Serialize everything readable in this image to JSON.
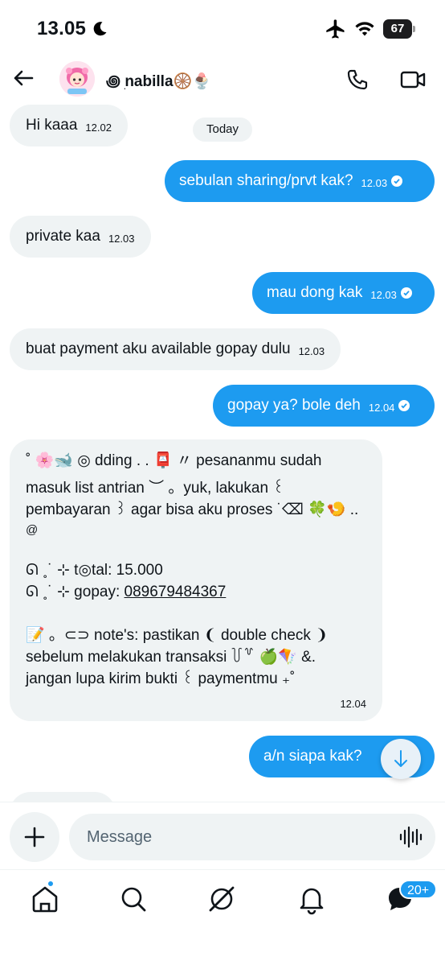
{
  "status_bar": {
    "time": "13.05",
    "battery": "67"
  },
  "header": {
    "back_label": "Back",
    "contact_name": "꩜ ׅnabilla🛞🍨"
  },
  "chat": {
    "date_separator": "Today",
    "messages": [
      {
        "dir": "in",
        "text": "Hi kaaa",
        "time": "12.02"
      },
      {
        "dir": "out",
        "text": "sebulan sharing/prvt kak?",
        "time": "12.03"
      },
      {
        "dir": "in",
        "text": "private kaa",
        "time": "12.03"
      },
      {
        "dir": "out",
        "text": "mau dong kak",
        "time": "12.03"
      },
      {
        "dir": "in",
        "text": "buat payment aku available gopay dulu",
        "time": "12.03"
      },
      {
        "dir": "out",
        "text": "gopay ya? bole deh",
        "time": "12.04"
      },
      {
        "dir": "out",
        "text": "a/n siapa kak?",
        "time": "12.04"
      }
    ],
    "long_message": {
      "lines": [
        "˚ 🌸🐋 ◎ dding . . 📮 〃 pesananmu sudah",
        "masuk list antrian ︶ 。yuk, lakukan ꒰",
        "pembayaran ꒱ agar bisa aku proses ˙⌫ 🍀🍤 ..",
        "@",
        "",
        "ᘏ ˳˙ ⊹ t◎tal: 15.000",
        "ᘏ ˳˙ ⊹ gopay: ",
        "",
        "📝 。⊂⊃ note's: pastikan ❨ double check ❩",
        "sebelum melakukan transaksi ꒦꒷ 🍏🪁 &.",
        "jangan lupa kirim bukti ꒰ paymentmu ₊˚"
      ],
      "phone": "089679484367",
      "time": "12.04"
    }
  },
  "composer": {
    "placeholder": "Message"
  },
  "nav": {
    "messages_badge": "20+"
  },
  "colors": {
    "accent": "#1d9bf0",
    "incoming_bubble": "#eff3f4",
    "text": "#0f1419"
  }
}
